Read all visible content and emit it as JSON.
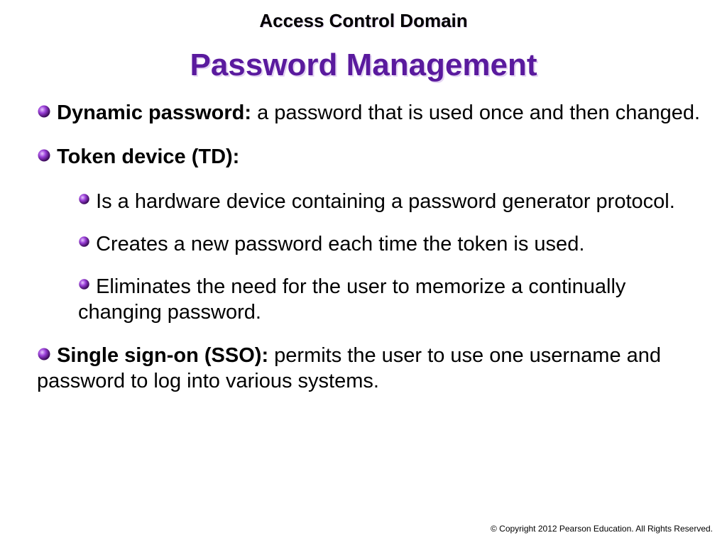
{
  "pretitle": "Access Control Domain",
  "title": "Password Management",
  "items": {
    "dynamic": {
      "term": "Dynamic password:",
      "def": " a password that is used once and then changed."
    },
    "token": {
      "term": "Token device (TD):",
      "subs": {
        "a": "Is a hardware device containing a password generator protocol.",
        "b": "Creates a new password each time the token is used.",
        "c": "Eliminates the need for the user to memorize a continually changing password."
      }
    },
    "sso": {
      "term": "Single sign-on (SSO):",
      "def": " permits the user to use one username and password to log into various systems."
    }
  },
  "footer": "© Copyright 2012 Pearson Education. All Rights Reserved."
}
